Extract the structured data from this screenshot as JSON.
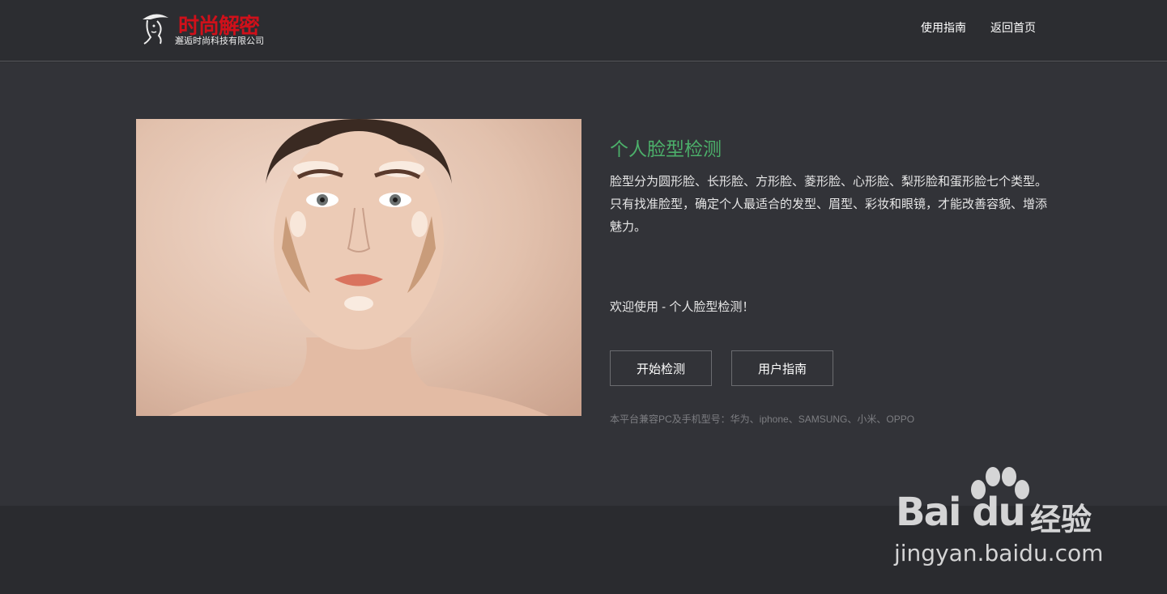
{
  "header": {
    "logo_title": "时尚解密",
    "logo_subtitle": "邂逅时尚科技有限公司",
    "nav": [
      {
        "label": "使用指南"
      },
      {
        "label": "返回首页"
      }
    ]
  },
  "main": {
    "title": "个人脸型检测",
    "description": "脸型分为圆形脸、长形脸、方形脸、菱形脸、心形脸、梨形脸和蛋形脸七个类型。只有找准脸型，确定个人最适合的发型、眉型、彩妆和眼镜，才能改善容貌、增添魅力。",
    "welcome": "欢迎使用 - 个人脸型检测！",
    "buttons": {
      "start": "开始检测",
      "guide": "用户指南"
    },
    "compat_note": "本平台兼容PC及手机型号：华为、iphone、SAMSUNG、小米、OPPO"
  },
  "watermark": {
    "logo": "Bai du",
    "cn": "经验",
    "url": "jingyan.baidu.com"
  },
  "colors": {
    "accent": "#4caf6a",
    "brand_red": "#d0101a",
    "background": "#323338"
  }
}
